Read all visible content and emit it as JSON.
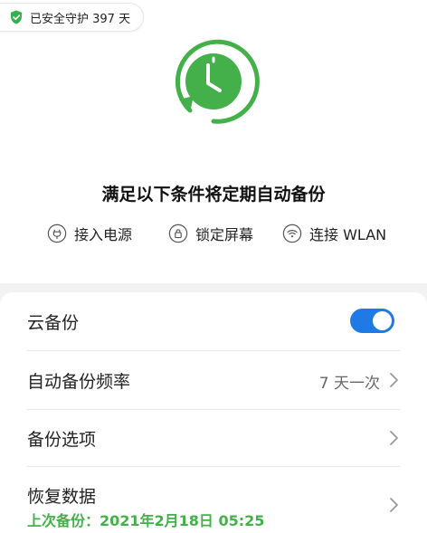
{
  "header": {
    "safe_text": "已安全守护 397 天"
  },
  "conditions": {
    "title": "满足以下条件将定期自动备份",
    "items": [
      {
        "label": "接入电源",
        "icon": "power-plug-icon"
      },
      {
        "label": "锁定屏幕",
        "icon": "lock-icon"
      },
      {
        "label": "连接 WLAN",
        "icon": "wifi-icon"
      }
    ]
  },
  "settings": {
    "cloud_backup_label": "云备份",
    "cloud_backup_on": true,
    "frequency_label": "自动备份频率",
    "frequency_value": "7 天一次",
    "options_label": "备份选项",
    "restore_label": "恢复数据",
    "last_backup_text": "上次备份：2021年2月18日 05:25"
  },
  "colors": {
    "accent_green": "#43b049",
    "toggle_blue": "#1f7ae6",
    "shield_green": "#2fb34a"
  }
}
